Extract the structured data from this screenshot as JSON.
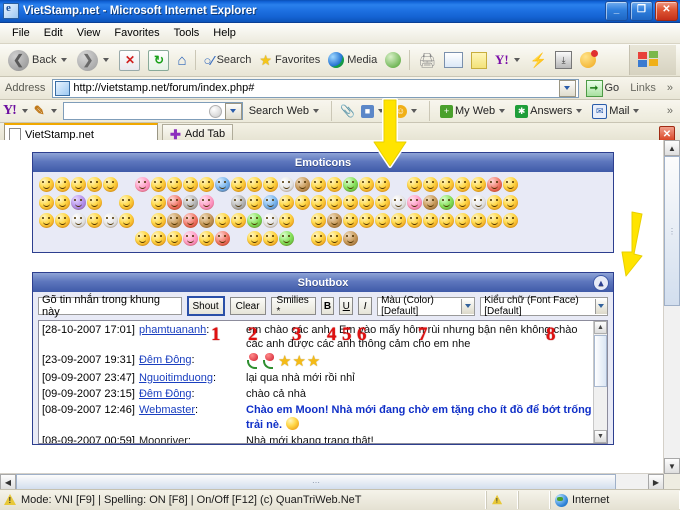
{
  "window": {
    "title": "VietStamp.net - Microsoft Internet Explorer",
    "icon": "ie-page-icon",
    "minimize": "_",
    "maximize": "❐",
    "close": "✕"
  },
  "menu": {
    "items": [
      "File",
      "Edit",
      "View",
      "Favorites",
      "Tools",
      "Help"
    ]
  },
  "toolbar": {
    "back": "Back",
    "forward": "",
    "stop": "✕",
    "refresh": "↻",
    "home": "⌂",
    "search": "Search",
    "favorites": "Favorites",
    "media": "Media",
    "history": "",
    "print": "⎙",
    "edit": "",
    "notes": "",
    "yahoo": "Y!",
    "messenger": "",
    "download": "⤓",
    "msn": ""
  },
  "address": {
    "label": "Address",
    "url": "http://vietstamp.net/forum/index.php#",
    "go": "Go",
    "links": "Links",
    "overflow": "»"
  },
  "yahoo_toolbar": {
    "logo": "Y!",
    "search_value": "",
    "search_button": "Search Web",
    "my_web": "My Web",
    "answers": "Answers",
    "mail": "Mail",
    "overflow": "»"
  },
  "tabs": {
    "items": [
      {
        "label": "VietStamp.net",
        "active": true
      }
    ],
    "add_tab": "Add Tab",
    "close_tab": "✕"
  },
  "emoticons": {
    "title": "Emoticons",
    "rows": [
      [
        "y",
        "y",
        "y",
        "y",
        "y",
        "gap",
        "pink",
        "y",
        "y",
        "y",
        "y",
        "blue",
        "y",
        "y",
        "y",
        "white",
        "brown",
        "y",
        "y",
        "green",
        "y",
        "y",
        "gap",
        "y",
        "y",
        "y",
        "y",
        "y",
        "red",
        "y"
      ],
      [
        "y",
        "y",
        "purple",
        "y",
        "gap",
        "y",
        "gap",
        "y",
        "red",
        "grey",
        "pink",
        "gap",
        "grey",
        "y",
        "blue",
        "y",
        "y",
        "y",
        "y",
        "y",
        "y",
        "y",
        "white",
        "pink",
        "brown",
        "green",
        "y",
        "white",
        "y",
        "y"
      ],
      [
        "y",
        "y",
        "white",
        "y",
        "white",
        "y",
        "gap",
        "y",
        "brown",
        "red",
        "brown",
        "y",
        "y",
        "green",
        "white",
        "y",
        "gap",
        "y",
        "brown",
        "y",
        "y",
        "y",
        "y",
        "y",
        "y",
        "y",
        "y",
        "y",
        "y",
        "y"
      ],
      [
        "gap",
        "gap",
        "gap",
        "gap",
        "gap",
        "gap",
        "y",
        "y",
        "y",
        "pink",
        "y",
        "red",
        "gap",
        "y",
        "y",
        "green",
        "gap",
        "y",
        "y",
        "brown",
        "gap",
        "gap",
        "gap",
        "gap",
        "gap",
        "gap",
        "gap",
        "gap",
        "gap",
        "gap"
      ]
    ]
  },
  "shoutbox": {
    "title": "Shoutbox",
    "collapse_icon": "⌃",
    "input_value": "Gõ tin nhắn trong khung này",
    "input_placeholder": "Gõ tin nhắn trong khung này",
    "buttons": {
      "shout": "Shout",
      "clear": "Clear",
      "smilies": "Smilies *",
      "bold": "B",
      "underline": "U",
      "italic": "I"
    },
    "selects": {
      "color": "Màu (Color) [Default]",
      "font": "Kiểu chữ (Font Face) [Default]"
    },
    "messages": [
      {
        "timestamp": "[28-10-2007 17:01]",
        "user": "phamtuananh",
        "linked": true,
        "text": "em chào các anh . Em vào mấy hôm rùi nhưng bận nên không chào các anh được các anh thông cảm cho em nhe",
        "style": "normal"
      },
      {
        "timestamp": "[23-09-2007 19:31]",
        "user": "Đêm Đông",
        "linked": true,
        "text": "",
        "style": "icons",
        "icons": [
          "rose",
          "rose",
          "star",
          "star",
          "star"
        ]
      },
      {
        "timestamp": "[09-09-2007 23:47]",
        "user": "Nguoitimduong",
        "linked": true,
        "text": "lại qua nhà mới rồi nhỉ",
        "style": "normal"
      },
      {
        "timestamp": "[09-09-2007 23:15]",
        "user": "Đêm Đông",
        "linked": true,
        "text": "chào cả nhà",
        "style": "normal"
      },
      {
        "timestamp": "[08-09-2007 12:46]",
        "user": "Webmaster",
        "linked": true,
        "text": "Chào em Moon! Nhà mới đang chờ em tặng cho ít đồ để bớt trống trải nè.",
        "style": "blue",
        "trailing_emoticon": true
      },
      {
        "timestamp": "[08-09-2007 00:59]",
        "user": "Moonriver",
        "linked": false,
        "text": "Nhà mới khang trang thật!",
        "style": "normal"
      }
    ]
  },
  "annotations": {
    "numbers": [
      "1",
      "2",
      "3",
      "4",
      "5",
      "6",
      "7",
      "8"
    ],
    "arrows": [
      "down-arrow-emoticons",
      "down-arrow-collapse",
      "down-arrow-yahoo-toolbar"
    ],
    "arrow_color": "#ffe400"
  },
  "statusbar": {
    "text": "Mode: VNI [F9] | Spelling: ON [F8] | On/Off [F12] (c) QuanTriWeb.NeT",
    "zone": "Internet",
    "warn_icon": "warning-icon",
    "globe_icon": "internet-globe-icon"
  },
  "colors": {
    "title_blue": "#1163d8",
    "panel_border": "#2d3f8f",
    "panel_head": "#5d76bd",
    "panel_bg": "#e8eaf6",
    "link_blue": "#1a3fc0",
    "msg_blue": "#1030c8",
    "annotation_red": "#e01010",
    "annotation_yellow": "#ffe400"
  }
}
